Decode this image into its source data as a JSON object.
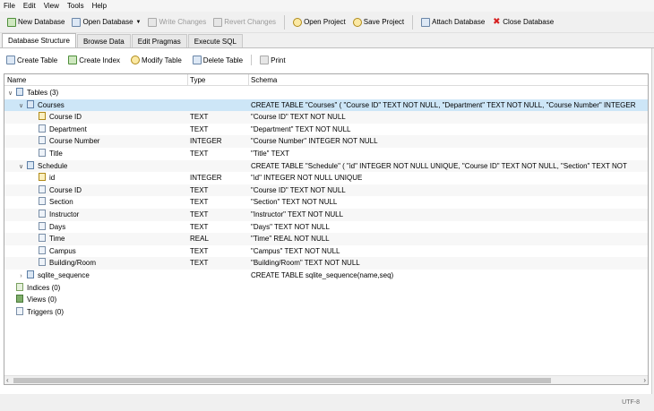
{
  "menu": [
    "File",
    "Edit",
    "View",
    "Tools",
    "Help"
  ],
  "toolbar": {
    "new_db": "New Database",
    "open_db": "Open Database",
    "write": "Write Changes",
    "revert": "Revert Changes",
    "open_project": "Open Project",
    "save_project": "Save Project",
    "attach": "Attach Database",
    "close": "Close Database"
  },
  "tabs": [
    "Database Structure",
    "Browse Data",
    "Edit Pragmas",
    "Execute SQL"
  ],
  "subtoolbar": {
    "create_table": "Create Table",
    "create_index": "Create Index",
    "modify_table": "Modify Table",
    "delete_table": "Delete Table",
    "print": "Print"
  },
  "columns": {
    "name": "Name",
    "type": "Type",
    "schema": "Schema"
  },
  "rows": [
    {
      "name": "Tables (3)",
      "type": "",
      "schema": ""
    },
    {
      "name": "Courses",
      "type": "",
      "schema": "CREATE TABLE \"Courses\" ( \"Course ID\" TEXT NOT NULL, \"Department\" TEXT NOT NULL, \"Course Number\" INTEGER"
    },
    {
      "name": "Course ID",
      "type": "TEXT",
      "schema": "\"Course ID\" TEXT NOT NULL"
    },
    {
      "name": "Department",
      "type": "TEXT",
      "schema": "\"Department\" TEXT NOT NULL"
    },
    {
      "name": "Course Number",
      "type": "INTEGER",
      "schema": "\"Course Number\" INTEGER NOT NULL"
    },
    {
      "name": "Title",
      "type": "TEXT",
      "schema": "\"Title\" TEXT"
    },
    {
      "name": "Schedule",
      "type": "",
      "schema": "CREATE TABLE \"Schedule\" ( \"id\" INTEGER NOT NULL UNIQUE, \"Course ID\" TEXT NOT NULL, \"Section\" TEXT NOT"
    },
    {
      "name": "id",
      "type": "INTEGER",
      "schema": "\"id\" INTEGER NOT NULL UNIQUE"
    },
    {
      "name": "Course ID",
      "type": "TEXT",
      "schema": "\"Course ID\" TEXT NOT NULL"
    },
    {
      "name": "Section",
      "type": "TEXT",
      "schema": "\"Section\" TEXT NOT NULL"
    },
    {
      "name": "Instructor",
      "type": "TEXT",
      "schema": "\"Instructor\" TEXT NOT NULL"
    },
    {
      "name": "Days",
      "type": "TEXT",
      "schema": "\"Days\" TEXT NOT NULL"
    },
    {
      "name": "Time",
      "type": "REAL",
      "schema": "\"Time\" REAL NOT NULL"
    },
    {
      "name": "Campus",
      "type": "TEXT",
      "schema": "\"Campus\" TEXT NOT NULL"
    },
    {
      "name": "Building/Room",
      "type": "TEXT",
      "schema": "\"Building/Room\" TEXT NOT NULL"
    },
    {
      "name": "sqlite_sequence",
      "type": "",
      "schema": "CREATE TABLE sqlite_sequence(name,seq)"
    },
    {
      "name": "Indices (0)",
      "type": "",
      "schema": ""
    },
    {
      "name": "Views (0)",
      "type": "",
      "schema": ""
    },
    {
      "name": "Triggers (0)",
      "type": "",
      "schema": ""
    }
  ],
  "status": {
    "encoding": "UTF-8"
  }
}
